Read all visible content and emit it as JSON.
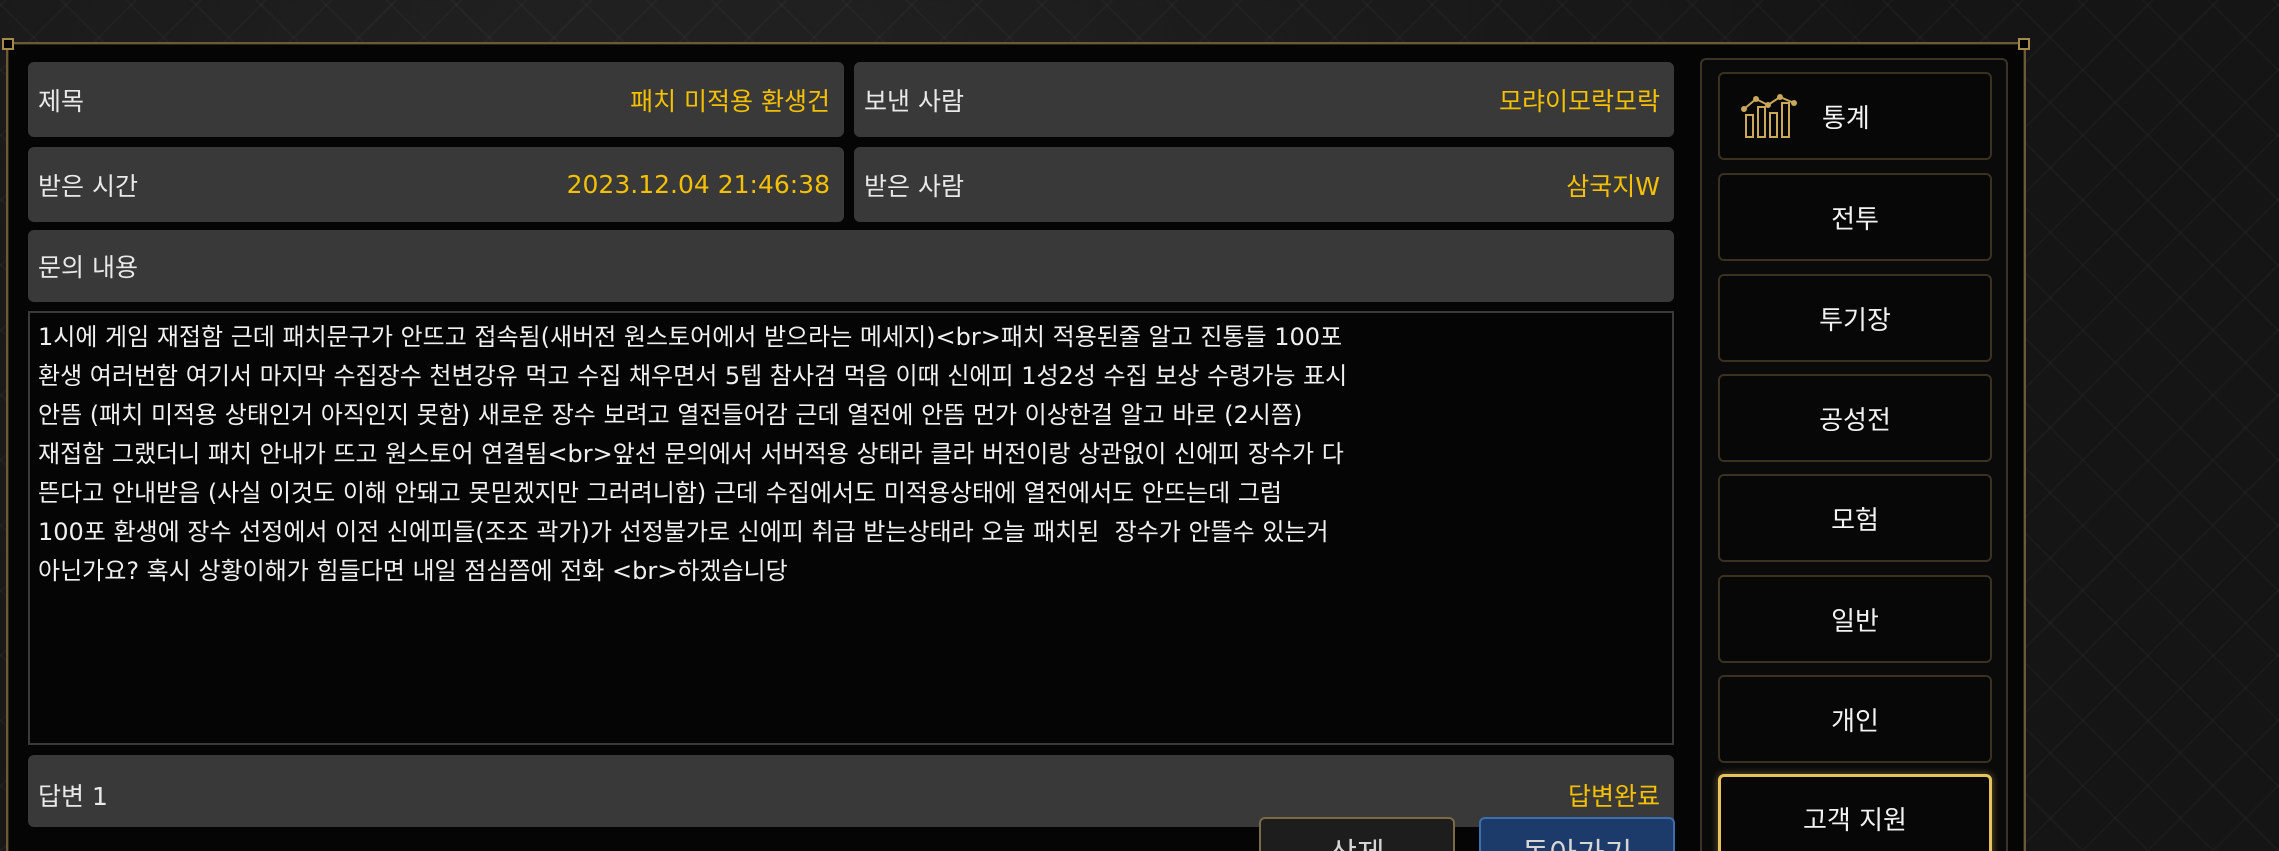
{
  "header": {
    "subject_label": "제목",
    "subject_value": "패치 미적용 환생건",
    "sender_label": "보낸 사람",
    "sender_value": "모랴이모락모락",
    "received_time_label": "받은 시간",
    "received_time_value": "2023.12.04 21:46:38",
    "recipient_label": "받은 사람",
    "recipient_value": "삼국지W"
  },
  "inquiry": {
    "label": "문의 내용",
    "body": "1시에 게임 재접함 근데 패치문구가 안뜨고 접속됨(새버전 원스토어에서 받으라는 메세지)<br>패치 적용된줄 알고 진통들 100포\n환생 여러번함 여기서 마지막 수집장수 천변강유 먹고 수집 채우면서 5텝 참사검 먹음 이때 신에피 1성2성 수집 보상 수령가능 표시\n안뜸 (패치 미적용 상태인거 아직인지 못함) 새로운 장수 보려고 열전들어감 근데 열전에 안뜸 먼가 이상한걸 알고 바로 (2시쯤)\n재접함 그랬더니 패치 안내가 뜨고 원스토어 연결됨<br>앞선 문의에서 서버적용 상태라 클라 버전이랑 상관없이 신에피 장수가 다\n뜬다고 안내받음 (사실 이것도 이해 안돼고 못믿겠지만 그러려니함) 근데 수집에서도 미적용상태에 열전에서도 안뜨는데 그럼\n100포 환생에 장수 선정에서 이전 신에피들(조조 곽가)가 선정불가로 신에피 취급 받는상태라 오늘 패치된  장수가 안뜰수 있는거\n아닌가요? 혹시 상황이해가 힘들다면 내일 점심쯤에 전화 <br>하겠습니당"
  },
  "answer": {
    "label": "답변 1",
    "status": "답변완료"
  },
  "buttons": {
    "delete_label": "삭제",
    "back_label": "돌아가기"
  },
  "sidebar": {
    "items": [
      {
        "label": "통계",
        "icon": "chart-icon"
      },
      {
        "label": "전투"
      },
      {
        "label": "투기장"
      },
      {
        "label": "공성전"
      },
      {
        "label": "모험"
      },
      {
        "label": "일반"
      },
      {
        "label": "개인"
      },
      {
        "label": "고객 지원",
        "active": true
      }
    ]
  },
  "colors": {
    "accent_gold": "#f4c000",
    "active_border": "#e8c25a",
    "back_button": "#1d3b6a"
  }
}
